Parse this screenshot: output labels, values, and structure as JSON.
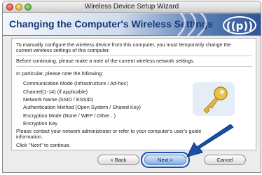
{
  "window": {
    "title": "Wireless Device Setup Wizard"
  },
  "banner": {
    "title": "Changing the Computer's Wireless Settings"
  },
  "content": {
    "intro_line1": "To manually configure the wireless device from this computer, you must temporarily change the",
    "intro_line2": "current wireless settings of this computer.",
    "note_line": "Before continuing, please make a note of the current wireless network settings.",
    "particular_heading": "In particular, please note the following:",
    "settings": [
      "Communication Mode (Infrastructure / Ad-hoc)",
      "Channel(1-14) (if applicable)",
      "Network Name (SSID / ESSID)",
      "Authentication Method (Open System / Shared Key)",
      "Encryption Mode (None / WEP / Other ..)",
      "Encryption Key"
    ],
    "contact_line1": "Please contact your network administrator or refer to your computer's user's guide",
    "contact_line2": "information.",
    "continue_line": "Click \"Next\" to continue."
  },
  "buttons": {
    "back": "< Back",
    "next": "Next >",
    "cancel": "Cancel"
  },
  "icons": {
    "banner_logo": "wireless-waves-icon",
    "key_image": "key-icon",
    "arrow": "pointer-arrow-icon"
  },
  "colors": {
    "banner_title": "#163a78",
    "highlight": "#1b4fb0"
  }
}
